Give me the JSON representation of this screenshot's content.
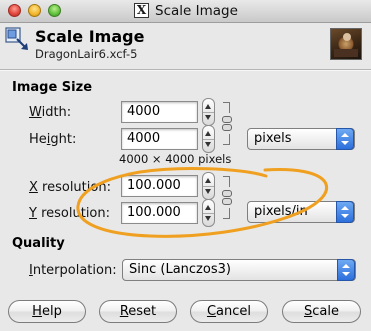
{
  "window": {
    "title": "Scale Image",
    "title_icon": "X"
  },
  "header": {
    "title": "Scale Image",
    "subtitle": "DragonLair6.xcf-5"
  },
  "image_size": {
    "section_label": "Image Size",
    "width_label_u": "W",
    "width_label_rest": "idth:",
    "width_value": "4000",
    "height_label_pre": "He",
    "height_label_u": "i",
    "height_label_rest": "ght:",
    "height_value": "4000",
    "size_unit": "pixels",
    "pixel_summary": "4000 × 4000 pixels",
    "x_res_label_u": "X",
    "x_res_label_rest": " resolution:",
    "x_res_value": "100.000",
    "y_res_label_u": "Y",
    "y_res_label_rest": " resolution:",
    "y_res_value": "100.000",
    "res_unit": "pixels/in"
  },
  "quality": {
    "section_label": "Quality",
    "interp_label_u": "I",
    "interp_label_rest": "nterpolation:",
    "interp_value": "Sinc (Lanczos3)"
  },
  "buttons": {
    "help_u": "H",
    "help_rest": "elp",
    "reset_u": "R",
    "reset_rest": "eset",
    "cancel_u": "C",
    "cancel_rest": "ancel",
    "scale_u": "S",
    "scale_rest": "cale"
  },
  "annotation": {
    "color": "#f0a020"
  }
}
